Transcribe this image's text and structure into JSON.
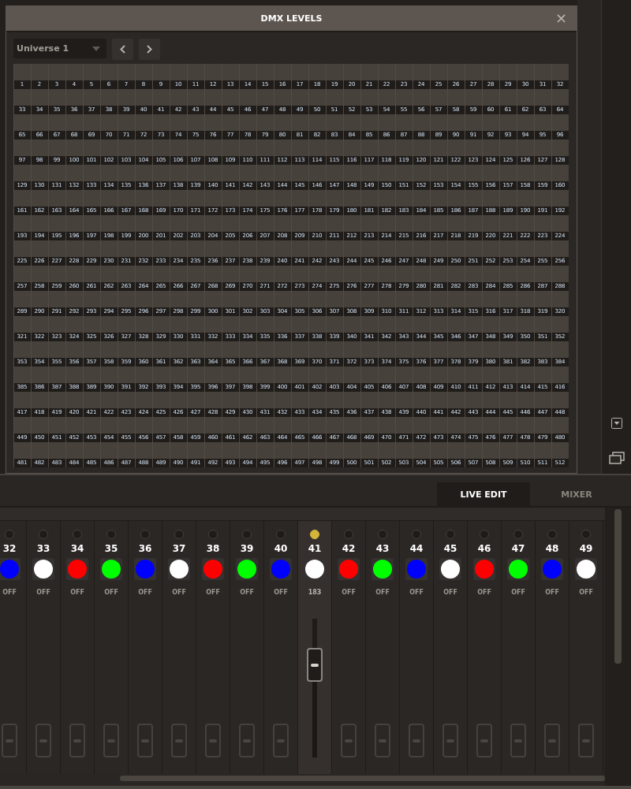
{
  "dialog": {
    "title": "DMX LEVELS",
    "close": "×",
    "universe": "Universe 1",
    "channels": [
      "1",
      "2",
      "3",
      "4",
      "5",
      "6",
      "7",
      "8",
      "9",
      "10",
      "11",
      "12",
      "13",
      "14",
      "15",
      "16",
      "17",
      "18",
      "19",
      "20",
      "21",
      "22",
      "23",
      "24",
      "25",
      "26",
      "27",
      "28",
      "29",
      "30",
      "31",
      "32",
      "33",
      "34",
      "35",
      "36",
      "37",
      "38",
      "39",
      "40",
      "41",
      "42",
      "43",
      "44",
      "45",
      "46",
      "47",
      "48",
      "49",
      "50",
      "51",
      "52",
      "53",
      "54",
      "55",
      "56",
      "57",
      "58",
      "59",
      "60",
      "61",
      "62",
      "63",
      "64",
      "65",
      "66",
      "67",
      "68",
      "69",
      "70",
      "71",
      "72",
      "73",
      "74",
      "75",
      "76",
      "77",
      "78",
      "79",
      "80",
      "81",
      "82",
      "83",
      "84",
      "85",
      "86",
      "87",
      "88",
      "89",
      "90",
      "91",
      "92",
      "93",
      "94",
      "95",
      "96",
      "97",
      "98",
      "99",
      "100",
      "101",
      "102",
      "103",
      "104",
      "105",
      "106",
      "107",
      "108",
      "109",
      "110",
      "111",
      "112",
      "113",
      "114",
      "115",
      "116",
      "117",
      "118",
      "119",
      "120",
      "121",
      "122",
      "123",
      "124",
      "125",
      "126",
      "127",
      "128",
      "129",
      "130",
      "131",
      "132",
      "133",
      "134",
      "135",
      "136",
      "137",
      "138",
      "139",
      "140",
      "141",
      "142",
      "143",
      "144",
      "145",
      "146",
      "147",
      "148",
      "149",
      "150",
      "151",
      "152",
      "153",
      "154",
      "155",
      "156",
      "157",
      "158",
      "159",
      "160",
      "161",
      "162",
      "163",
      "164",
      "165",
      "166",
      "167",
      "168",
      "169",
      "170",
      "171",
      "172",
      "173",
      "174",
      "175",
      "176",
      "177",
      "178",
      "179",
      "180",
      "181",
      "182",
      "183",
      "184",
      "185",
      "186",
      "187",
      "188",
      "189",
      "190",
      "191",
      "192",
      "193",
      "194",
      "195",
      "196",
      "197",
      "198",
      "199",
      "200",
      "201",
      "202",
      "203",
      "204",
      "205",
      "206",
      "207",
      "208",
      "209",
      "210",
      "211",
      "212",
      "213",
      "214",
      "215",
      "216",
      "217",
      "218",
      "219",
      "220",
      "221",
      "222",
      "223",
      "224",
      "225",
      "226",
      "227",
      "228",
      "229",
      "230",
      "231",
      "232",
      "233",
      "234",
      "235",
      "236",
      "237",
      "238",
      "239",
      "240",
      "241",
      "242",
      "243",
      "244",
      "245",
      "246",
      "247",
      "248",
      "249",
      "250",
      "251",
      "252",
      "253",
      "254",
      "255",
      "256",
      "257",
      "258",
      "259",
      "260",
      "261",
      "262",
      "263",
      "264",
      "265",
      "266",
      "267",
      "268",
      "269",
      "270",
      "271",
      "272",
      "273",
      "274",
      "275",
      "276",
      "277",
      "278",
      "279",
      "280",
      "281",
      "282",
      "283",
      "284",
      "285",
      "286",
      "287",
      "288",
      "289",
      "290",
      "291",
      "292",
      "293",
      "294",
      "295",
      "296",
      "297",
      "298",
      "299",
      "300",
      "301",
      "302",
      "303",
      "304",
      "305",
      "306",
      "307",
      "308",
      "309",
      "310",
      "311",
      "312",
      "313",
      "314",
      "315",
      "316",
      "317",
      "318",
      "319",
      "320",
      "321",
      "322",
      "323",
      "324",
      "325",
      "326",
      "327",
      "328",
      "329",
      "330",
      "331",
      "332",
      "333",
      "334",
      "335",
      "336",
      "337",
      "338",
      "339",
      "340",
      "341",
      "342",
      "343",
      "344",
      "345",
      "346",
      "347",
      "348",
      "349",
      "350",
      "351",
      "352",
      "353",
      "354",
      "355",
      "356",
      "357",
      "358",
      "359",
      "360",
      "361",
      "362",
      "363",
      "364",
      "365",
      "366",
      "367",
      "368",
      "369",
      "370",
      "371",
      "372",
      "373",
      "374",
      "375",
      "376",
      "377",
      "378",
      "379",
      "380",
      "381",
      "382",
      "383",
      "384",
      "385",
      "386",
      "387",
      "388",
      "389",
      "390",
      "391",
      "392",
      "393",
      "394",
      "395",
      "396",
      "397",
      "398",
      "399",
      "400",
      "401",
      "402",
      "403",
      "404",
      "405",
      "406",
      "407",
      "408",
      "409",
      "410",
      "411",
      "412",
      "413",
      "414",
      "415",
      "416",
      "417",
      "418",
      "419",
      "420",
      "421",
      "422",
      "423",
      "424",
      "425",
      "426",
      "427",
      "428",
      "429",
      "430",
      "431",
      "432",
      "433",
      "434",
      "435",
      "436",
      "437",
      "438",
      "439",
      "440",
      "441",
      "442",
      "443",
      "444",
      "445",
      "446",
      "447",
      "448",
      "449",
      "450",
      "451",
      "452",
      "453",
      "454",
      "455",
      "456",
      "457",
      "458",
      "459",
      "460",
      "461",
      "462",
      "463",
      "464",
      "465",
      "466",
      "467",
      "468",
      "469",
      "470",
      "471",
      "472",
      "473",
      "474",
      "475",
      "476",
      "477",
      "478",
      "479",
      "480",
      "481",
      "482",
      "483",
      "484",
      "485",
      "486",
      "487",
      "488",
      "489",
      "490",
      "491",
      "492",
      "493",
      "494",
      "495",
      "496",
      "497",
      "498",
      "499",
      "500",
      "501",
      "502",
      "503",
      "504",
      "505",
      "506",
      "507",
      "508",
      "509",
      "510",
      "511",
      "512"
    ]
  },
  "tabs": [
    {
      "label": "LIVE EDIT",
      "selected": true
    },
    {
      "label": "MIXER",
      "selected": false
    }
  ],
  "mixer": [
    {
      "number": "32",
      "color": "#0000ff",
      "value": "OFF",
      "selected": false
    },
    {
      "number": "33",
      "color": "#ffffff",
      "value": "OFF",
      "selected": false
    },
    {
      "number": "34",
      "color": "#ff0000",
      "value": "OFF",
      "selected": false
    },
    {
      "number": "35",
      "color": "#00ff00",
      "value": "OFF",
      "selected": false
    },
    {
      "number": "36",
      "color": "#0000ff",
      "value": "OFF",
      "selected": false
    },
    {
      "number": "37",
      "color": "#ffffff",
      "value": "OFF",
      "selected": false
    },
    {
      "number": "38",
      "color": "#ff0000",
      "value": "OFF",
      "selected": false
    },
    {
      "number": "39",
      "color": "#00ff00",
      "value": "OFF",
      "selected": false
    },
    {
      "number": "40",
      "color": "#0000ff",
      "value": "OFF",
      "selected": false
    },
    {
      "number": "41",
      "color": "#ffffff",
      "value": "183",
      "selected": true,
      "level": 0.72
    },
    {
      "number": "42",
      "color": "#ff0000",
      "value": "OFF",
      "selected": false
    },
    {
      "number": "43",
      "color": "#00ff00",
      "value": "OFF",
      "selected": false
    },
    {
      "number": "44",
      "color": "#0000ff",
      "value": "OFF",
      "selected": false
    },
    {
      "number": "45",
      "color": "#ffffff",
      "value": "OFF",
      "selected": false
    },
    {
      "number": "46",
      "color": "#ff0000",
      "value": "OFF",
      "selected": false
    },
    {
      "number": "47",
      "color": "#00ff00",
      "value": "OFF",
      "selected": false
    },
    {
      "number": "48",
      "color": "#0000ff",
      "value": "OFF",
      "selected": false
    },
    {
      "number": "49",
      "color": "#ffffff",
      "value": "OFF",
      "selected": false
    }
  ]
}
